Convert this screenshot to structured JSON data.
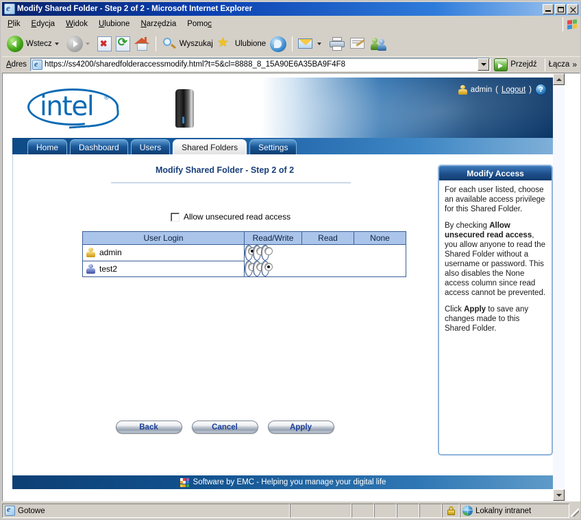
{
  "window": {
    "title": "Modify Shared Folder - Step 2 of 2 - Microsoft Internet Explorer",
    "icon": "ie-document-icon",
    "minimize_label": "Minimize",
    "maximize_label": "Maximize",
    "close_label": "Close"
  },
  "menubar": {
    "items": [
      {
        "label": "Plik",
        "accesskey": "P"
      },
      {
        "label": "Edycja",
        "accesskey": "E"
      },
      {
        "label": "Widok",
        "accesskey": "W"
      },
      {
        "label": "Ulubione",
        "accesskey": "U"
      },
      {
        "label": "Narzędzia",
        "accesskey": "N"
      },
      {
        "label": "Pomoc",
        "accesskey": "c"
      }
    ]
  },
  "toolbar": {
    "back_label": "Wstecz",
    "search_label": "Wyszukaj",
    "favorites_label": "Ulubione",
    "icons": [
      "back-icon",
      "forward-icon",
      "stop-icon",
      "refresh-icon",
      "home-icon",
      "search-icon",
      "favorites-star-icon",
      "media-icon",
      "mail-icon",
      "print-icon",
      "edit-icon",
      "messenger-icon"
    ]
  },
  "address": {
    "label": "Adres",
    "url": "https://ss4200/sharedfolderaccessmodify.html?t=5&cl=8888_8_15A90E6A35BA9F4F8",
    "go_label": "Przejdź",
    "links_label": "Łącza",
    "links_chevron": "»"
  },
  "intel": {
    "brand": "intel",
    "registered_mark": "®",
    "device_name": "ss4200",
    "user_name": "admin",
    "logout_label": "Logout",
    "logout_open_paren": "(",
    "logout_close_paren": ")",
    "help_glyph": "?",
    "tabs": [
      {
        "label": "Home",
        "active": false
      },
      {
        "label": "Dashboard",
        "active": false
      },
      {
        "label": "Users",
        "active": false
      },
      {
        "label": "Shared Folders",
        "active": true
      },
      {
        "label": "Settings",
        "active": false
      }
    ],
    "page_title": "Modify Shared Folder - Step 2 of 2",
    "unsecured_checkbox_label": "Allow unsecured read access",
    "unsecured_checked": false,
    "table": {
      "headers": [
        "User Login",
        "Read/Write",
        "Read",
        "None"
      ],
      "rows": [
        {
          "user": "admin",
          "icon": "user-gold-icon",
          "selection": "Read/Write"
        },
        {
          "user": "test2",
          "icon": "user-blue-icon",
          "selection": "None"
        }
      ]
    },
    "buttons": [
      {
        "label": "Back"
      },
      {
        "label": "Cancel"
      },
      {
        "label": "Apply"
      }
    ],
    "help_panel": {
      "title": "Modify Access",
      "paragraphs": [
        {
          "parts": [
            {
              "text": "For each user listed, choose an available access privilege for this Shared Folder.",
              "bold": false
            }
          ]
        },
        {
          "parts": [
            {
              "text": "By checking ",
              "bold": false
            },
            {
              "text": "Allow unsecured read access",
              "bold": true
            },
            {
              "text": ", you allow anyone to read the Shared Folder without a username or password. This also disables the None access column since read access cannot be prevented.",
              "bold": false
            }
          ]
        },
        {
          "parts": [
            {
              "text": "Click ",
              "bold": false
            },
            {
              "text": "Apply",
              "bold": true
            },
            {
              "text": " to save any changes made to this Shared Folder.",
              "bold": false
            }
          ]
        }
      ]
    },
    "footer_text": "Software by EMC - Helping you manage your digital life",
    "footer_logo": "emc-logo",
    "colors": {
      "intel_blue": "#0b6bb5",
      "header_blue": "#0d3f74",
      "table_header": "#aac4ea",
      "table_border": "#3a5f96",
      "title_text": "#1a3f7a",
      "button_text": "#1a3f9a"
    }
  },
  "statusbar": {
    "status_text": "Gotowe",
    "zone_text": "Lokalny intranet",
    "lock_icon": "ssl-lock-icon",
    "zone_icon": "intranet-globe-icon"
  }
}
